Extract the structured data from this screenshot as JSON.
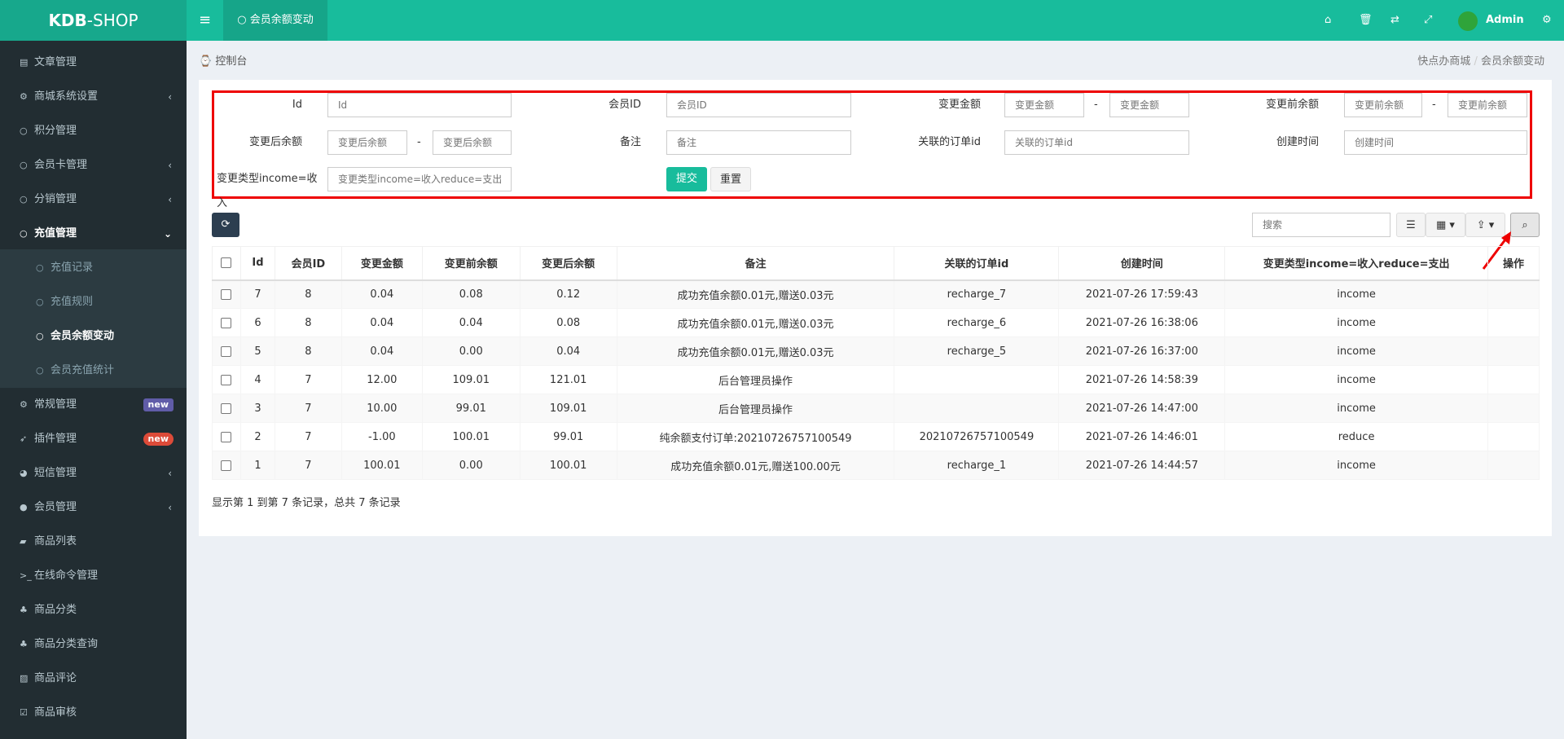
{
  "header": {
    "logo_bold": "KDB",
    "logo_rest": "-SHOP",
    "tab": "会员余额变动",
    "user": "Admin"
  },
  "sidebar": {
    "items": [
      {
        "label": "文章管理",
        "icon": "file-icon"
      },
      {
        "label": "商城系统设置",
        "icon": "cogs-icon",
        "arrow": "‹"
      },
      {
        "label": "积分管理",
        "icon": "circle-icon"
      },
      {
        "label": "会员卡管理",
        "icon": "circle-icon",
        "arrow": "‹"
      },
      {
        "label": "分销管理",
        "icon": "circle-icon",
        "arrow": "‹"
      },
      {
        "label": "充值管理",
        "icon": "circle-icon",
        "arrow": "⌄"
      },
      {
        "label": "充值记录",
        "icon": "circle-icon"
      },
      {
        "label": "充值规则",
        "icon": "circle-icon"
      },
      {
        "label": "会员余额变动",
        "icon": "circle-icon"
      },
      {
        "label": "会员充值统计",
        "icon": "circle-icon"
      },
      {
        "label": "常规管理",
        "icon": "cogs-icon",
        "badge": "new",
        "badge_color": "#605ca8"
      },
      {
        "label": "插件管理",
        "icon": "rocket-icon",
        "badge": "new",
        "badge_color": "#dd4b39"
      },
      {
        "label": "短信管理",
        "icon": "wechat-icon",
        "arrow": "‹"
      },
      {
        "label": "会员管理",
        "icon": "user-icon",
        "arrow": "‹"
      },
      {
        "label": "商品列表",
        "icon": "shopping-bag-icon"
      },
      {
        "label": "在线命令管理",
        "icon": "terminal-icon"
      },
      {
        "label": "商品分类",
        "icon": "sitemap-icon"
      },
      {
        "label": "商品分类查询",
        "icon": "sitemap-icon"
      },
      {
        "label": "商品评论",
        "icon": "edit-icon"
      },
      {
        "label": "商品审核",
        "icon": "check-square-icon"
      }
    ]
  },
  "breadcrumb": {
    "left": "控制台",
    "home": "快点办商城",
    "current": "会员余额变动"
  },
  "form": {
    "id_label": "Id",
    "id_ph": "Id",
    "uid_label": "会员ID",
    "uid_ph": "会员ID",
    "amount_label": "变更金额",
    "amount_ph": "变更金额",
    "before_label": "变更前余额",
    "before_ph": "变更前余额",
    "after_label": "变更后余额",
    "after_ph": "变更后余额",
    "memo_label": "备注",
    "memo_ph": "备注",
    "order_label": "关联的订单id",
    "order_ph": "关联的订单id",
    "time_label": "创建时间",
    "time_ph": "创建时间",
    "type_label": "变更类型income=收入",
    "type_ph": "变更类型income=收入reduce=支出",
    "dash": "-",
    "submit": "提交",
    "reset": "重置"
  },
  "toolbar": {
    "search_ph": "搜索"
  },
  "table": {
    "headers": [
      "Id",
      "会员ID",
      "变更金额",
      "变更前余额",
      "变更后余额",
      "备注",
      "关联的订单id",
      "创建时间",
      "变更类型income=收入reduce=支出",
      "操作"
    ],
    "rows": [
      [
        "7",
        "8",
        "0.04",
        "0.08",
        "0.12",
        "成功充值余额0.01元,赠送0.03元",
        "recharge_7",
        "2021-07-26 17:59:43",
        "income",
        ""
      ],
      [
        "6",
        "8",
        "0.04",
        "0.04",
        "0.08",
        "成功充值余额0.01元,赠送0.03元",
        "recharge_6",
        "2021-07-26 16:38:06",
        "income",
        ""
      ],
      [
        "5",
        "8",
        "0.04",
        "0.00",
        "0.04",
        "成功充值余额0.01元,赠送0.03元",
        "recharge_5",
        "2021-07-26 16:37:00",
        "income",
        ""
      ],
      [
        "4",
        "7",
        "12.00",
        "109.01",
        "121.01",
        "后台管理员操作",
        "",
        "2021-07-26 14:58:39",
        "income",
        ""
      ],
      [
        "3",
        "7",
        "10.00",
        "99.01",
        "109.01",
        "后台管理员操作",
        "",
        "2021-07-26 14:47:00",
        "income",
        ""
      ],
      [
        "2",
        "7",
        "-1.00",
        "100.01",
        "99.01",
        "纯余额支付订单:20210726757100549",
        "20210726757100549",
        "2021-07-26 14:46:01",
        "reduce",
        ""
      ],
      [
        "1",
        "7",
        "100.01",
        "0.00",
        "100.01",
        "成功充值余额0.01元,赠送100.00元",
        "recharge_1",
        "2021-07-26 14:44:57",
        "income",
        ""
      ]
    ]
  },
  "footer": "显示第 1 到第 7 条记录，总共 7 条记录",
  "colors": {
    "header": "#18bc9c",
    "sidebar": "#222d32",
    "highlight": "#e00000"
  }
}
